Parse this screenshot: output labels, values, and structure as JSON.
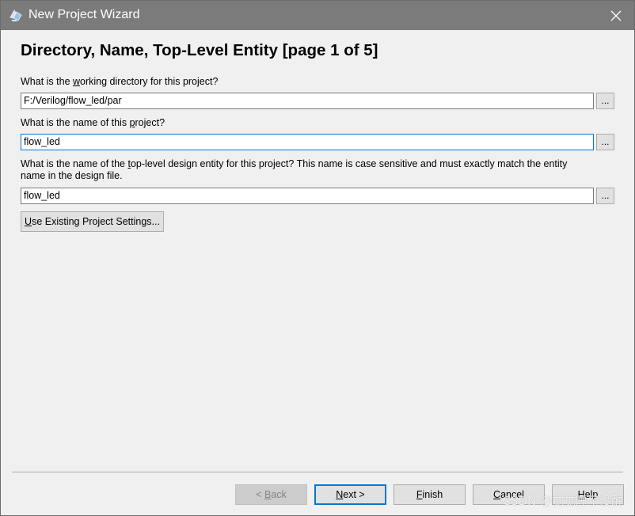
{
  "window": {
    "title": "New Project Wizard",
    "title_bar_color": "#7b7b7b",
    "app_icon": "quartus-wizard-icon",
    "close_icon": "close-icon"
  },
  "page": {
    "heading": "Directory, Name, Top-Level Entity [page 1 of 5]"
  },
  "fields": {
    "working_directory": {
      "label_pre": "What is the ",
      "label_mnemonic": "w",
      "label_post": "orking directory for this project?",
      "value": "F:/Verilog/flow_led/par",
      "browse_label": "..."
    },
    "project_name": {
      "label_pre": "What is the name of this ",
      "label_mnemonic": "p",
      "label_post": "roject?",
      "value": "flow_led",
      "browse_label": "..."
    },
    "top_level_entity": {
      "label_pre": "What is the name of the ",
      "label_mnemonic": "t",
      "label_line1_post": "op-level design entity for this project? This name is case sensitive and must exactly match the entity",
      "label_line2": "name in the design file.",
      "value": "flow_led",
      "browse_label": "..."
    }
  },
  "existing_settings_button": {
    "mnemonic": "U",
    "rest": "se Existing Project Settings..."
  },
  "footer": {
    "back": {
      "pre": "< ",
      "mnemonic": "B",
      "post": "ack"
    },
    "next": {
      "pre": "",
      "mnemonic": "N",
      "post": "ext >"
    },
    "finish": {
      "pre": "",
      "mnemonic": "F",
      "post": "inish"
    },
    "cancel": {
      "pre": "",
      "mnemonic": "C",
      "post": "ancel"
    },
    "help": {
      "pre": "",
      "mnemonic": "H",
      "post": "elp"
    }
  },
  "watermark": "CSDN @觉觉睡了没醒",
  "colors": {
    "focus_border": "#0078d7",
    "dialog_bg": "#f0f0f0",
    "button_bg": "#e1e1e1"
  }
}
